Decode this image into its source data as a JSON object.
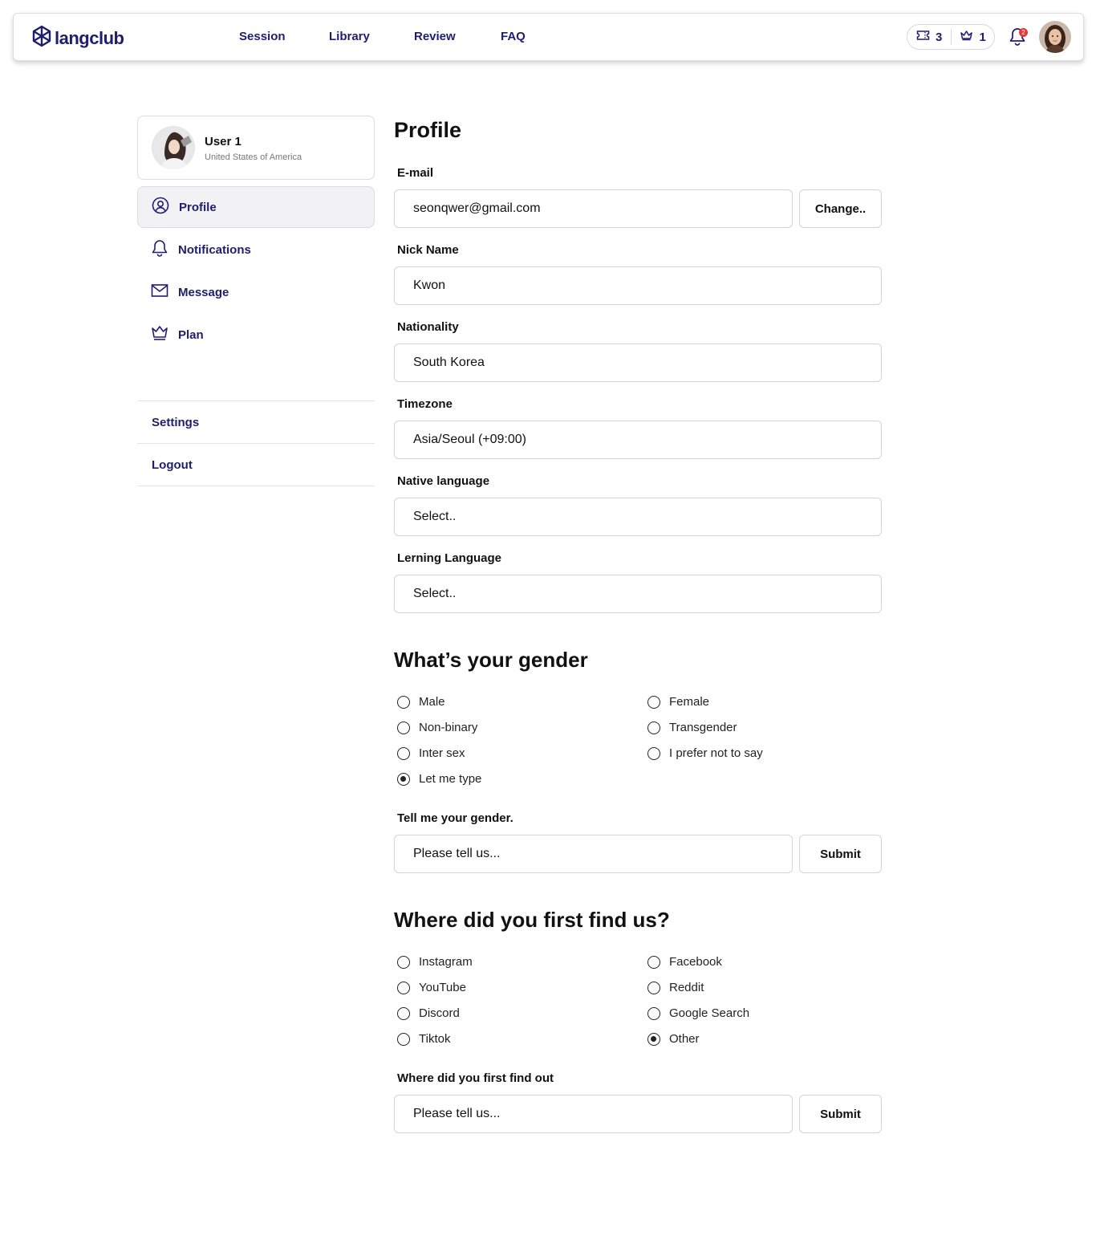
{
  "brand": {
    "name": "langclub",
    "color": "#1f1d6e"
  },
  "nav": {
    "items": [
      "Session",
      "Library",
      "Review",
      "FAQ"
    ]
  },
  "header": {
    "tickets_count": "3",
    "crowns_count": "1",
    "notification_badge": "2"
  },
  "sidebar": {
    "user": {
      "name": "User 1",
      "country": "United States of America"
    },
    "items": [
      {
        "label": "Profile",
        "icon": "user-circle-icon",
        "active": true
      },
      {
        "label": "Notifications",
        "icon": "bell-icon"
      },
      {
        "label": "Message",
        "icon": "mail-icon"
      },
      {
        "label": "Plan",
        "icon": "crown-icon"
      }
    ],
    "links": [
      "Settings",
      "Logout"
    ]
  },
  "profile": {
    "title": "Profile",
    "email": {
      "label": "E-mail",
      "value": "seonqwer@gmail.com",
      "button": "Change.."
    },
    "nickname": {
      "label": "Nick Name",
      "value": "Kwon"
    },
    "nationality": {
      "label": "Nationality",
      "value": "South Korea"
    },
    "timezone": {
      "label": "Timezone",
      "value": "Asia/Seoul (+09:00)"
    },
    "native_language": {
      "label": "Native language",
      "value": "Select.."
    },
    "learning_language": {
      "label": "Lerning Language",
      "value": "Select.."
    }
  },
  "gender": {
    "title": "What’s your gender",
    "options": [
      {
        "label": "Male",
        "selected": false
      },
      {
        "label": "Female",
        "selected": false
      },
      {
        "label": "Non-binary",
        "selected": false
      },
      {
        "label": "Transgender",
        "selected": false
      },
      {
        "label": "Inter sex",
        "selected": false
      },
      {
        "label": "I prefer not to say",
        "selected": false
      },
      {
        "label": "Let me type",
        "selected": true
      }
    ],
    "input_label": "Tell me your gender.",
    "placeholder": "Please tell us...",
    "button": "Submit"
  },
  "source": {
    "title": "Where did you first find us?",
    "options": [
      {
        "label": "Instagram",
        "selected": false
      },
      {
        "label": "Facebook",
        "selected": false
      },
      {
        "label": "YouTube",
        "selected": false
      },
      {
        "label": "Reddit",
        "selected": false
      },
      {
        "label": "Discord",
        "selected": false
      },
      {
        "label": "Google Search",
        "selected": false
      },
      {
        "label": "Tiktok",
        "selected": false
      },
      {
        "label": "Other",
        "selected": true
      }
    ],
    "input_label": "Where did you first find out",
    "placeholder": "Please tell us...",
    "button": "Submit"
  }
}
